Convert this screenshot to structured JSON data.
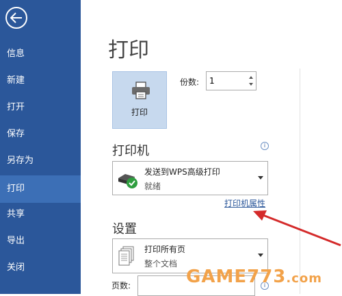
{
  "sidebar": {
    "items": [
      {
        "label": "信息"
      },
      {
        "label": "新建"
      },
      {
        "label": "打开"
      },
      {
        "label": "保存"
      },
      {
        "label": "另存为"
      },
      {
        "label": "打印",
        "active": true
      },
      {
        "label": "共享"
      },
      {
        "label": "导出"
      },
      {
        "label": "关闭"
      }
    ]
  },
  "main": {
    "title": "打印",
    "print_button_label": "打印",
    "copies": {
      "label": "份数:",
      "value": "1"
    },
    "printer_section": {
      "title": "打印机",
      "selected": "发送到WPS高级打印",
      "status": "就绪",
      "properties_link": "打印机属性"
    },
    "settings_section": {
      "title": "设置",
      "selected": "打印所有页",
      "subtitle": "整个文档",
      "pages_label": "页数:",
      "pages_value": ""
    }
  },
  "watermark": {
    "main": "GAME773",
    "suffix": ".com"
  },
  "colors": {
    "sidebar": "#2b579a",
    "active_item": "#3c6fb6",
    "print_button": "#c7d9ee",
    "link": "#2b579a",
    "arrow": "#d42a2a"
  }
}
